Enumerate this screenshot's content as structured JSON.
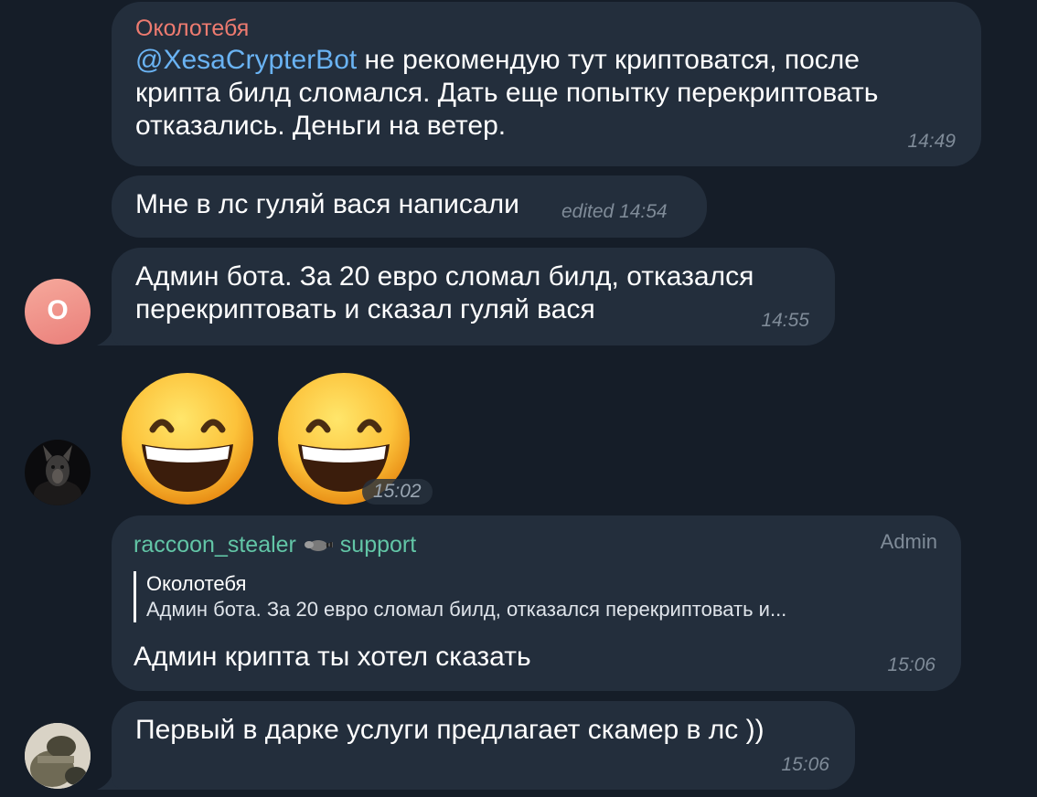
{
  "messages": [
    {
      "sender": "Околотебя",
      "mention": "@XesaCrypterBot",
      "line1": " не рекомендую тут криптоватся, после",
      "line2": "крипта билд сломался. Дать еще попытку перекриптовать",
      "line3": "отказались. Деньги на ветер.",
      "time": "14:49"
    },
    {
      "text": "Мне в лс гуляй вася написали",
      "edited": "edited",
      "time": "14:54"
    },
    {
      "line1": "Админ бота. За 20 евро сломал билд, отказался",
      "line2": "перекриптовать и сказал гуляй вася",
      "time": "14:55",
      "avatar_letter": "О"
    },
    {
      "emoji": "😄😄",
      "time": "15:02"
    },
    {
      "sender": "raccoon_stealer",
      "sender_suffix": "support",
      "badge": "Admin",
      "reply_name": "Околотебя",
      "reply_text": "Админ бота. За 20 евро сломал билд, отказался перекриптовать и...",
      "text": "Админ крипта ты хотел сказать",
      "time": "15:06"
    },
    {
      "text": "Первый в дарке услуги предлагает скамер в лс ))",
      "time": "15:06"
    }
  ],
  "colors": {
    "background": "#151d28",
    "bubble": "#232e3c",
    "sender_okolo": "#ee7b70",
    "sender_raccoon": "#62c5a6",
    "mention": "#6ab3f3",
    "time": "#7f8b98",
    "avatar_o": "#f08f86"
  },
  "icons": {
    "raccoon": "raccoon-emoji",
    "emoji": "grinning-face-with-smiling-eyes"
  }
}
